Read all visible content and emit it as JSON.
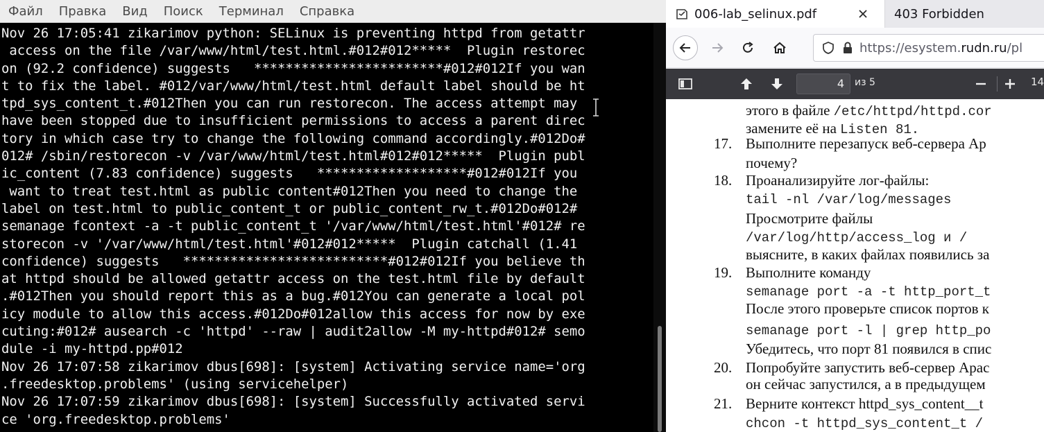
{
  "terminal": {
    "menu": [
      "Файл",
      "Правка",
      "Вид",
      "Поиск",
      "Терминал",
      "Справка"
    ],
    "lines": [
      "Nov 26 17:05:41 zikarimov python: SELinux is preventing httpd from getattr",
      " access on the file /var/www/html/test.html.#012#012*****  Plugin restorec",
      "on (92.2 confidence) suggests   ************************#012#012If you wan",
      "t to fix the label. #012/var/www/html/test.html default label should be ht",
      "tpd_sys_content_t.#012Then you can run restorecon. The access attempt may ",
      "have been stopped due to insufficient permissions to access a parent direc",
      "tory in which case try to change the following command accordingly.#012Do#",
      "012# /sbin/restorecon -v /var/www/html/test.html#012#012*****  Plugin publ",
      "ic_content (7.83 confidence) suggests   *******************#012#012If you",
      " want to treat test.html as public content#012Then you need to change the",
      "label on test.html to public_content_t or public_content_rw_t.#012Do#012#",
      "semanage fcontext -a -t public_content_t '/var/www/html/test.html'#012# re",
      "storecon -v '/var/www/html/test.html'#012#012*****  Plugin catchall (1.41",
      "confidence) suggests   **************************#012#012If you believe th",
      "at httpd should be allowed getattr access on the test.html file by default",
      ".#012Then you should report this as a bug.#012You can generate a local pol",
      "icy module to allow this access.#012Do#012allow this access for now by exe",
      "cuting:#012# ausearch -c 'httpd' --raw | audit2allow -M my-httpd#012# semo",
      "dule -i my-httpd.pp#012",
      "Nov 26 17:07:58 zikarimov dbus[698]: [system] Activating service name='org",
      ".freedesktop.problems' (using servicehelper)",
      "Nov 26 17:07:59 zikarimov dbus[698]: [system] Successfully activated servi",
      "ce 'org.freedesktop.problems'"
    ]
  },
  "browser": {
    "tabs": [
      {
        "title": "006-lab_selinux.pdf",
        "active": true,
        "icon": "document-icon"
      },
      {
        "title": "403 Forbidden",
        "active": false
      }
    ],
    "url": {
      "prefix": "https://esystem.",
      "domain": "rudn.ru",
      "suffix": "/pl"
    },
    "pdf_toolbar": {
      "page_current": "4",
      "page_total": "из 5",
      "zoom_value": "14"
    }
  },
  "pdf": {
    "lines": [
      {
        "kind": "serif+mono",
        "parts": [
          "этого в файле ",
          "/etc/httpd/httpd.cor"
        ]
      },
      {
        "kind": "serif+mono",
        "parts": [
          "замените её на ",
          "Listen 81."
        ]
      },
      {
        "kind": "item",
        "num": "17.",
        "text": "Выполните перезапуск веб-сервера Ар"
      },
      {
        "kind": "serif",
        "text": "почему?"
      },
      {
        "kind": "item",
        "num": "18.",
        "text": "Проанализируйте лог-файлы:"
      },
      {
        "kind": "mono",
        "text": "tail -nl /var/log/messages"
      },
      {
        "kind": "serif",
        "text": "Просмотрите                файлы"
      },
      {
        "kind": "mono",
        "text": "/var/log/http/access_log  и  /"
      },
      {
        "kind": "serif",
        "text": "выясните, в каких файлах появились за"
      },
      {
        "kind": "item",
        "num": "19.",
        "text": "Выполните команду"
      },
      {
        "kind": "mono",
        "text": "semanage port -a -t http_port_t"
      },
      {
        "kind": "serif",
        "text": "После этого проверьте список портов к"
      },
      {
        "kind": "mono",
        "text": "semanage port -l | grep http_po"
      },
      {
        "kind": "serif",
        "text": "Убедитесь, что порт 81 появился в спис"
      },
      {
        "kind": "item",
        "num": "20.",
        "text": "Попробуйте запустить веб-сервер Арас"
      },
      {
        "kind": "serif",
        "text": "он сейчас запустился, а в предыдущем"
      },
      {
        "kind": "item",
        "num": "21.",
        "text": "Верните контекст httpd_sys_content__t"
      },
      {
        "kind": "mono",
        "text": "chcon -t httpd_sys_content_t /"
      }
    ]
  },
  "colors": {
    "terminal_bg": "#000000",
    "terminal_fg": "#f2f2f2",
    "pdf_toolbar_bg": "#38383d"
  }
}
